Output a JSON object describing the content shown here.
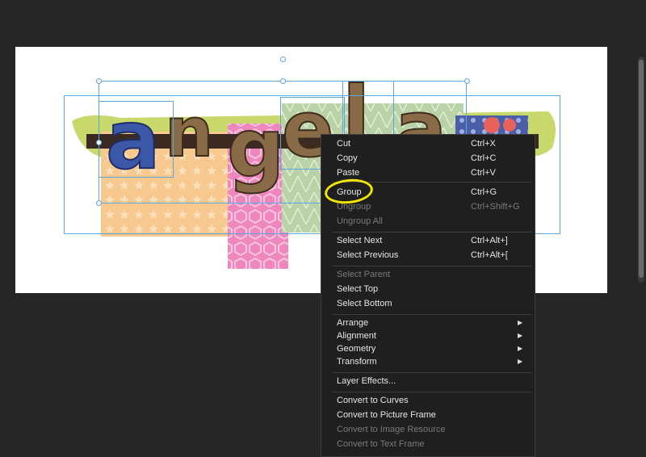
{
  "canvas": {
    "letters": [
      "a",
      "n",
      "g",
      "e",
      "l",
      "a"
    ],
    "colors": {
      "paper_orange": "#f7c98e",
      "paper_green": "#b9d2a6",
      "paper_pink": "#ef86bd",
      "paper_blue": "#4a5fa6",
      "paper_lime": "#c9d86a",
      "paper_red": "#e8615a",
      "brown_band": "#3a2a22",
      "letter_blue": "#3b57a8",
      "letter_brown": "#8a6b48",
      "selection": "#5aa6e0"
    }
  },
  "context_menu": {
    "items": [
      {
        "label": "Cut",
        "shortcut": "Ctrl+X",
        "enabled": true
      },
      {
        "label": "Copy",
        "shortcut": "Ctrl+C",
        "enabled": true
      },
      {
        "label": "Paste",
        "shortcut": "Ctrl+V",
        "enabled": true
      },
      {
        "label": "Group",
        "shortcut": "Ctrl+G",
        "enabled": true
      },
      {
        "label": "Ungroup",
        "shortcut": "Ctrl+Shift+G",
        "enabled": false
      },
      {
        "label": "Ungroup All",
        "shortcut": "",
        "enabled": false
      },
      {
        "label": "Select Next",
        "shortcut": "Ctrl+Alt+]",
        "enabled": true
      },
      {
        "label": "Select Previous",
        "shortcut": "Ctrl+Alt+[",
        "enabled": true
      },
      {
        "label": "Select Parent",
        "shortcut": "",
        "enabled": false
      },
      {
        "label": "Select Top",
        "shortcut": "",
        "enabled": true
      },
      {
        "label": "Select Bottom",
        "shortcut": "",
        "enabled": true
      },
      {
        "label": "Arrange",
        "shortcut": "",
        "enabled": true,
        "submenu": true
      },
      {
        "label": "Alignment",
        "shortcut": "",
        "enabled": true,
        "submenu": true
      },
      {
        "label": "Geometry",
        "shortcut": "",
        "enabled": true,
        "submenu": true
      },
      {
        "label": "Transform",
        "shortcut": "",
        "enabled": true,
        "submenu": true
      },
      {
        "label": "Layer Effects...",
        "shortcut": "",
        "enabled": true
      },
      {
        "label": "Convert to Curves",
        "shortcut": "",
        "enabled": true
      },
      {
        "label": "Convert to Picture Frame",
        "shortcut": "",
        "enabled": true
      },
      {
        "label": "Convert to Image Resource",
        "shortcut": "",
        "enabled": false
      },
      {
        "label": "Convert to Text Frame",
        "shortcut": "",
        "enabled": false
      }
    ],
    "submenu_arrow_icon": "triangle-right-icon",
    "annotation_color": "#f2e600"
  }
}
